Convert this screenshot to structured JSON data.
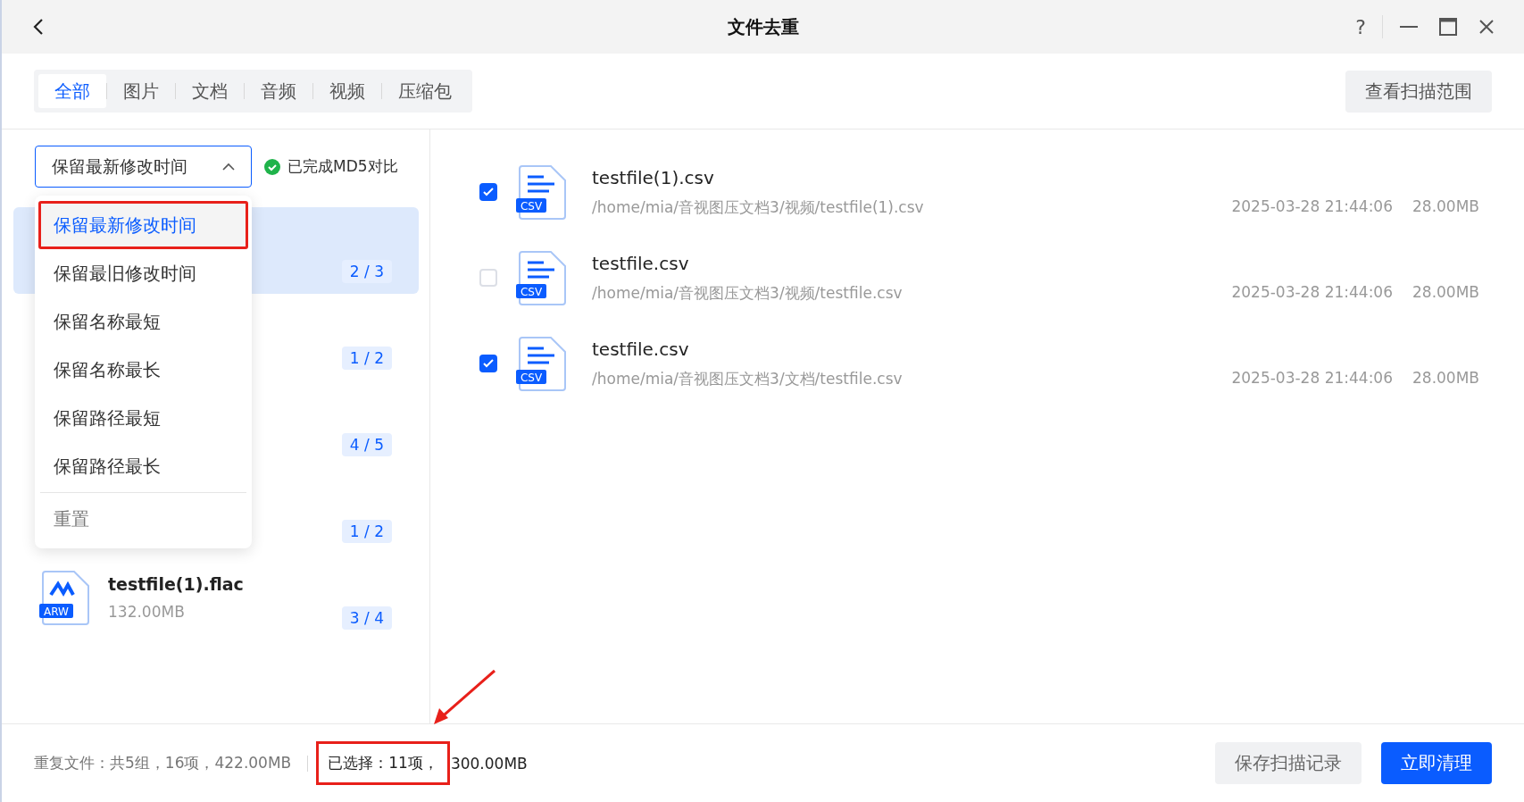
{
  "window": {
    "title": "文件去重",
    "help": "?"
  },
  "tabs": [
    {
      "label": "全部",
      "selected": true
    },
    {
      "label": "图片",
      "selected": false
    },
    {
      "label": "文档",
      "selected": false
    },
    {
      "label": "音频",
      "selected": false
    },
    {
      "label": "视频",
      "selected": false
    },
    {
      "label": "压缩包",
      "selected": false
    }
  ],
  "scan_range_button": "查看扫描范围",
  "keep_rule": {
    "value": "保留最新修改时间",
    "expanded": true,
    "options": [
      {
        "label": "保留最新修改时间",
        "selected": true,
        "highlighted": true,
        "kind": "rule"
      },
      {
        "label": "保留最旧修改时间",
        "selected": false,
        "highlighted": false,
        "kind": "rule"
      },
      {
        "label": "保留名称最短",
        "selected": false,
        "highlighted": false,
        "kind": "rule"
      },
      {
        "label": "保留名称最长",
        "selected": false,
        "highlighted": false,
        "kind": "rule"
      },
      {
        "label": "保留路径最短",
        "selected": false,
        "highlighted": false,
        "kind": "rule"
      },
      {
        "label": "保留路径最长",
        "selected": false,
        "highlighted": false,
        "kind": "rule"
      },
      {
        "label": "重置",
        "selected": false,
        "highlighted": false,
        "kind": "reset"
      }
    ]
  },
  "md5_status": "已完成MD5对比",
  "groups": [
    {
      "count": "2 / 3",
      "selected": true
    },
    {
      "count": "1 / 2",
      "selected": false
    },
    {
      "count": "4 / 5",
      "selected": false
    },
    {
      "count": "1 / 2",
      "selected": false
    },
    {
      "name": "testfile(1).flac",
      "size": "132.00MB",
      "count": "3 / 4",
      "badge": "ARW",
      "selected": false
    }
  ],
  "files": [
    {
      "name": "testfile(1).csv",
      "path": "/home/mia/音视图压文档3/视频/testfile(1).csv",
      "date": "2025-03-28 21:44:06",
      "size": "28.00MB",
      "badge": "CSV",
      "checked": true
    },
    {
      "name": "testfile.csv",
      "path": "/home/mia/音视图压文档3/视频/testfile.csv",
      "date": "2025-03-28 21:44:06",
      "size": "28.00MB",
      "badge": "CSV",
      "checked": false
    },
    {
      "name": "testfile.csv",
      "path": "/home/mia/音视图压文档3/文档/testfile.csv",
      "date": "2025-03-28 21:44:06",
      "size": "28.00MB",
      "badge": "CSV",
      "checked": true
    }
  ],
  "status_bar": {
    "summary": "重复文件：共5组，16项，422.00MB",
    "selected_count": "已选择：11项，",
    "selected_size": "300.00MB",
    "highlighted": true
  },
  "buttons": [
    {
      "label": "保存扫描记录",
      "kind": "secondary"
    },
    {
      "label": "立即清理",
      "kind": "primary"
    }
  ]
}
